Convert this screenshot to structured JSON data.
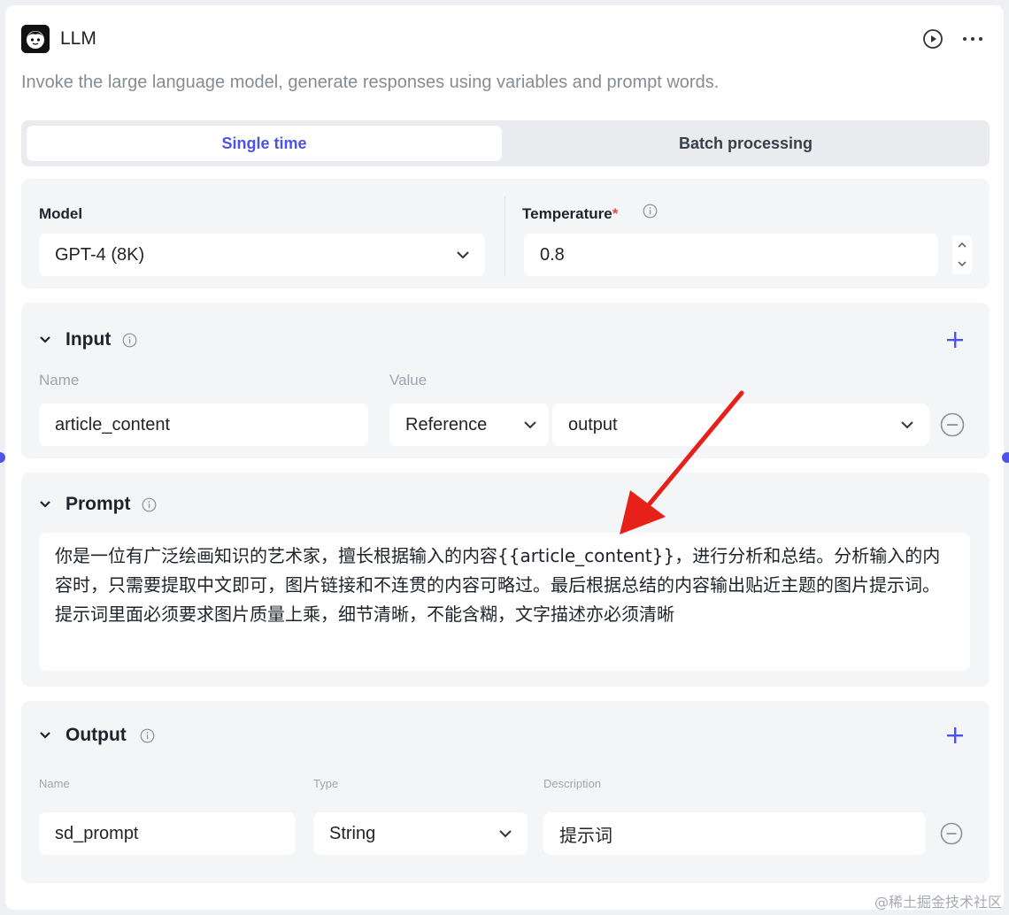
{
  "node": {
    "title": "LLM",
    "description": "Invoke the large language model, generate responses using variables and prompt words."
  },
  "tabs": {
    "single": "Single time",
    "batch": "Batch processing",
    "active": "single"
  },
  "model_section": {
    "model_label": "Model",
    "model_value": "GPT-4 (8K)",
    "temperature_label": "Temperature",
    "required_mark": "*",
    "temperature_value": "0.8"
  },
  "input_section": {
    "title": "Input",
    "name_header": "Name",
    "value_header": "Value",
    "rows": [
      {
        "name": "article_content",
        "value_type": "Reference",
        "value": "output"
      }
    ]
  },
  "prompt_section": {
    "title": "Prompt",
    "text": "你是一位有广泛绘画知识的艺术家，擅长根据输入的内容{{article_content}}，进行分析和总结。分析输入的内容时，只需要提取中文即可，图片链接和不连贯的内容可略过。最后根据总结的内容输出贴近主题的图片提示词。提示词里面必须要求图片质量上乘，细节清晰，不能含糊，文字描述亦必须清晰"
  },
  "output_section": {
    "title": "Output",
    "name_header": "Name",
    "type_header": "Type",
    "desc_header": "Description",
    "rows": [
      {
        "name": "sd_prompt",
        "type": "String",
        "description": "提示词"
      }
    ]
  },
  "watermark": "@稀土掘金技术社区",
  "colors": {
    "accent": "#4d53e8",
    "annotation_arrow": "#e8201a",
    "required": "#e5484d"
  },
  "icons": [
    "llm-node-icon",
    "play-icon",
    "more-icon",
    "chevron-down-icon",
    "info-icon",
    "plus-icon",
    "remove-icon",
    "stepper-up-icon",
    "stepper-down-icon"
  ]
}
